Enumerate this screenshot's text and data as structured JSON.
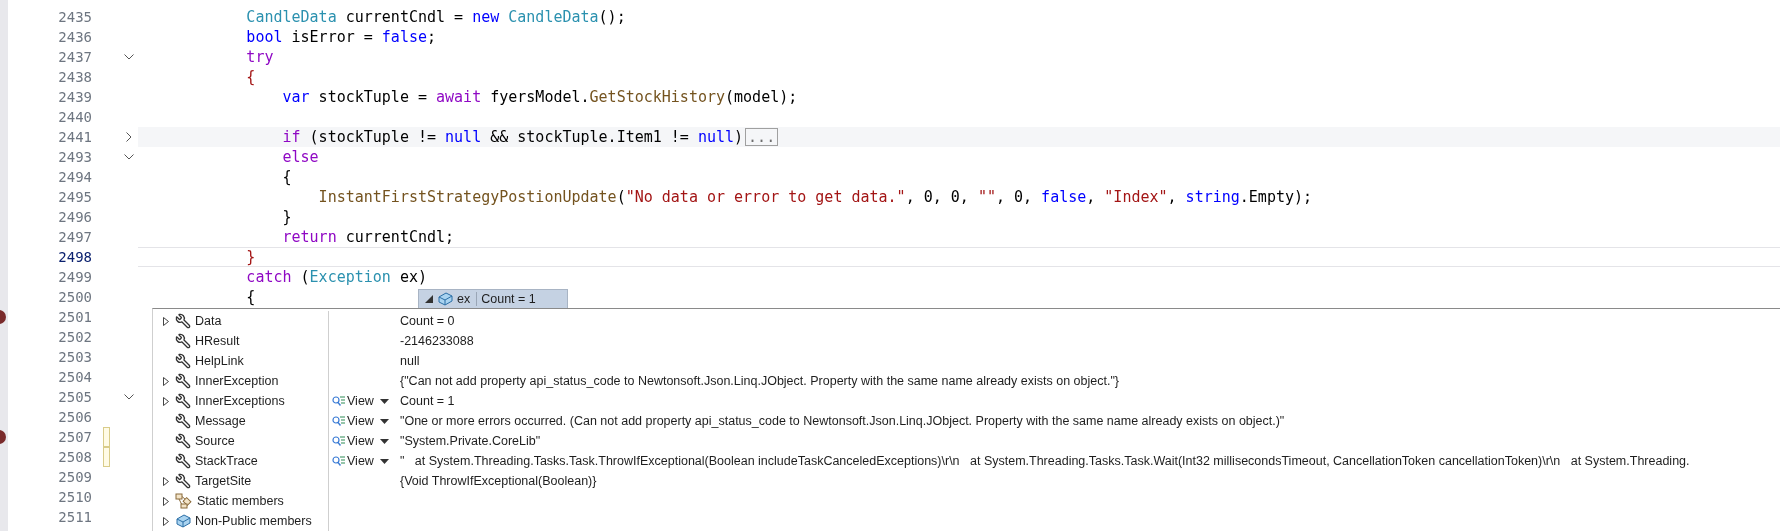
{
  "editor": {
    "lines": [
      {
        "number": "2435",
        "breakpoint": false,
        "current": false,
        "highlighted": false,
        "changed": false,
        "tokens": [
          {
            "text": "            CandleData",
            "kind": "type"
          },
          {
            "text": " currentCndl = ",
            "kind": "plain"
          },
          {
            "text": "new",
            "kind": "keyword"
          },
          {
            "text": " CandleData",
            "kind": "type"
          },
          {
            "text": "();",
            "kind": "plain"
          }
        ]
      },
      {
        "number": "2436",
        "breakpoint": false,
        "current": false,
        "highlighted": false,
        "changed": false,
        "tokens": [
          {
            "text": "            bool",
            "kind": "keyword"
          },
          {
            "text": " isError = ",
            "kind": "plain"
          },
          {
            "text": "false",
            "kind": "keyword"
          },
          {
            "text": ";",
            "kind": "plain"
          }
        ]
      },
      {
        "number": "2437",
        "expanded": true,
        "breakpoint": false,
        "current": false,
        "highlighted": false,
        "changed": false,
        "tokens": [
          {
            "text": "            try",
            "kind": "control"
          }
        ]
      },
      {
        "number": "2438",
        "breakpoint": false,
        "current": false,
        "highlighted": false,
        "changed": false,
        "tokens": [
          {
            "text": "            {",
            "kind": "brace"
          }
        ]
      },
      {
        "number": "2439",
        "breakpoint": false,
        "current": false,
        "highlighted": false,
        "changed": false,
        "tokens": [
          {
            "text": "                var",
            "kind": "keyword"
          },
          {
            "text": " stockTuple = ",
            "kind": "plain"
          },
          {
            "text": "await",
            "kind": "control"
          },
          {
            "text": " fyersModel.",
            "kind": "plain"
          },
          {
            "text": "GetStockHistory",
            "kind": "method"
          },
          {
            "text": "(model);",
            "kind": "plain"
          }
        ]
      },
      {
        "number": "2440",
        "breakpoint": false,
        "current": false,
        "highlighted": false,
        "changed": false
      },
      {
        "number": "2441",
        "expanded": false,
        "breakpoint": false,
        "current": false,
        "highlighted": true,
        "changed": false,
        "tokens": [
          {
            "text": "                if",
            "kind": "control"
          },
          {
            "text": " (stockTuple != ",
            "kind": "plain"
          },
          {
            "text": "null",
            "kind": "keyword"
          },
          {
            "text": " && stockTuple.Item1 != ",
            "kind": "plain"
          },
          {
            "text": "null",
            "kind": "keyword"
          },
          {
            "text": ")",
            "kind": "plain"
          },
          {
            "text": "...",
            "kind": "collapsed"
          }
        ]
      },
      {
        "number": "2493",
        "expanded": true,
        "breakpoint": false,
        "current": false,
        "highlighted": false,
        "changed": false,
        "tokens": [
          {
            "text": "                else",
            "kind": "control"
          }
        ]
      },
      {
        "number": "2494",
        "breakpoint": false,
        "current": false,
        "highlighted": false,
        "changed": false,
        "tokens": [
          {
            "text": "                {",
            "kind": "plain"
          }
        ]
      },
      {
        "number": "2495",
        "breakpoint": false,
        "current": false,
        "highlighted": false,
        "changed": false,
        "tokens": [
          {
            "text": "                    InstantFirstStrategyPostionUpdate",
            "kind": "method"
          },
          {
            "text": "(",
            "kind": "plain"
          },
          {
            "text": "\"No data or error to get data.\"",
            "kind": "string"
          },
          {
            "text": ", 0, 0, ",
            "kind": "plain"
          },
          {
            "text": "\"\"",
            "kind": "string"
          },
          {
            "text": ", 0, ",
            "kind": "plain"
          },
          {
            "text": "false",
            "kind": "keyword"
          },
          {
            "text": ", ",
            "kind": "plain"
          },
          {
            "text": "\"Index\"",
            "kind": "string"
          },
          {
            "text": ", ",
            "kind": "plain"
          },
          {
            "text": "string",
            "kind": "keyword"
          },
          {
            "text": ".Empty);",
            "kind": "plain"
          }
        ]
      },
      {
        "number": "2496",
        "breakpoint": false,
        "current": false,
        "highlighted": false,
        "changed": false,
        "tokens": [
          {
            "text": "                }",
            "kind": "plain"
          }
        ]
      },
      {
        "number": "2497",
        "breakpoint": false,
        "current": false,
        "highlighted": false,
        "changed": false,
        "tokens": [
          {
            "text": "                return",
            "kind": "control"
          },
          {
            "text": " currentCndl;",
            "kind": "plain"
          }
        ]
      },
      {
        "number": "2498",
        "breakpoint": false,
        "current": true,
        "highlighted": false,
        "changed": false,
        "tokens": [
          {
            "text": "            }",
            "kind": "brace"
          }
        ]
      },
      {
        "number": "2499",
        "breakpoint": false,
        "current": false,
        "highlighted": false,
        "changed": false,
        "tokens": [
          {
            "text": "            catch",
            "kind": "control"
          },
          {
            "text": " (",
            "kind": "plain"
          },
          {
            "text": "Exception",
            "kind": "type"
          },
          {
            "text": " ex)",
            "kind": "plain"
          }
        ]
      },
      {
        "number": "2500",
        "breakpoint": false,
        "current": false,
        "highlighted": false,
        "changed": false,
        "tokens": [
          {
            "text": "            {",
            "kind": "plain"
          }
        ]
      },
      {
        "number": "2501",
        "breakpoint": true,
        "current": false,
        "highlighted": false,
        "changed": false
      },
      {
        "number": "2502",
        "breakpoint": false,
        "current": false,
        "highlighted": false,
        "changed": false
      },
      {
        "number": "2503",
        "breakpoint": false,
        "current": false,
        "highlighted": false,
        "changed": false
      },
      {
        "number": "2504",
        "breakpoint": false,
        "current": false,
        "highlighted": false,
        "changed": false
      },
      {
        "number": "2505",
        "expanded": true,
        "breakpoint": false,
        "current": false,
        "highlighted": false,
        "changed": false
      },
      {
        "number": "2506",
        "breakpoint": false,
        "current": false,
        "highlighted": false,
        "changed": false
      },
      {
        "number": "2507",
        "breakpoint": true,
        "current": false,
        "highlighted": false,
        "changed": true
      },
      {
        "number": "2508",
        "breakpoint": false,
        "current": false,
        "highlighted": false,
        "changed": true
      },
      {
        "number": "2509",
        "breakpoint": false,
        "current": false,
        "highlighted": false,
        "changed": false
      },
      {
        "number": "2510",
        "breakpoint": false,
        "current": false,
        "highlighted": false,
        "changed": false
      },
      {
        "number": "2511",
        "breakpoint": false,
        "current": false,
        "highlighted": false,
        "changed": false
      }
    ]
  },
  "datatip": {
    "header": {
      "name": "ex",
      "value": "Count = 1"
    },
    "rows": [
      {
        "name": "Data",
        "kind": "property",
        "expandable": true,
        "value": "Count = 0"
      },
      {
        "name": "HResult",
        "kind": "property",
        "expandable": false,
        "value": "-2146233088"
      },
      {
        "name": "HelpLink",
        "kind": "property",
        "expandable": false,
        "value": "null"
      },
      {
        "name": "InnerException",
        "kind": "property",
        "expandable": true,
        "value": "{\"Can not add property api_status_code to Newtonsoft.Json.Linq.JObject. Property with the same name already exists on object.\"}"
      },
      {
        "name": "InnerExceptions",
        "kind": "property",
        "expandable": true,
        "view": "View",
        "value": "Count = 1"
      },
      {
        "name": "Message",
        "kind": "property",
        "expandable": false,
        "view": "View",
        "value": "\"One or more errors occurred. (Can not add property api_status_code to Newtonsoft.Json.Linq.JObject. Property with the same name already exists on object.)\""
      },
      {
        "name": "Source",
        "kind": "property",
        "expandable": false,
        "view": "View",
        "value": "\"System.Private.CoreLib\""
      },
      {
        "name": "StackTrace",
        "kind": "property",
        "expandable": false,
        "view": "View",
        "value": "\"   at System.Threading.Tasks.Task.ThrowIfExceptional(Boolean includeTaskCanceledExceptions)\\r\\n   at System.Threading.Tasks.Task.Wait(Int32 millisecondsTimeout, CancellationToken cancellationToken)\\r\\n   at System.Threading."
      },
      {
        "name": "TargetSite",
        "kind": "property",
        "expandable": true,
        "value": "{Void ThrowIfExceptional(Boolean)}"
      },
      {
        "name": "Static members",
        "kind": "static",
        "expandable": true
      },
      {
        "name": "Non-Public members",
        "kind": "nonpublic",
        "expandable": true
      }
    ]
  }
}
